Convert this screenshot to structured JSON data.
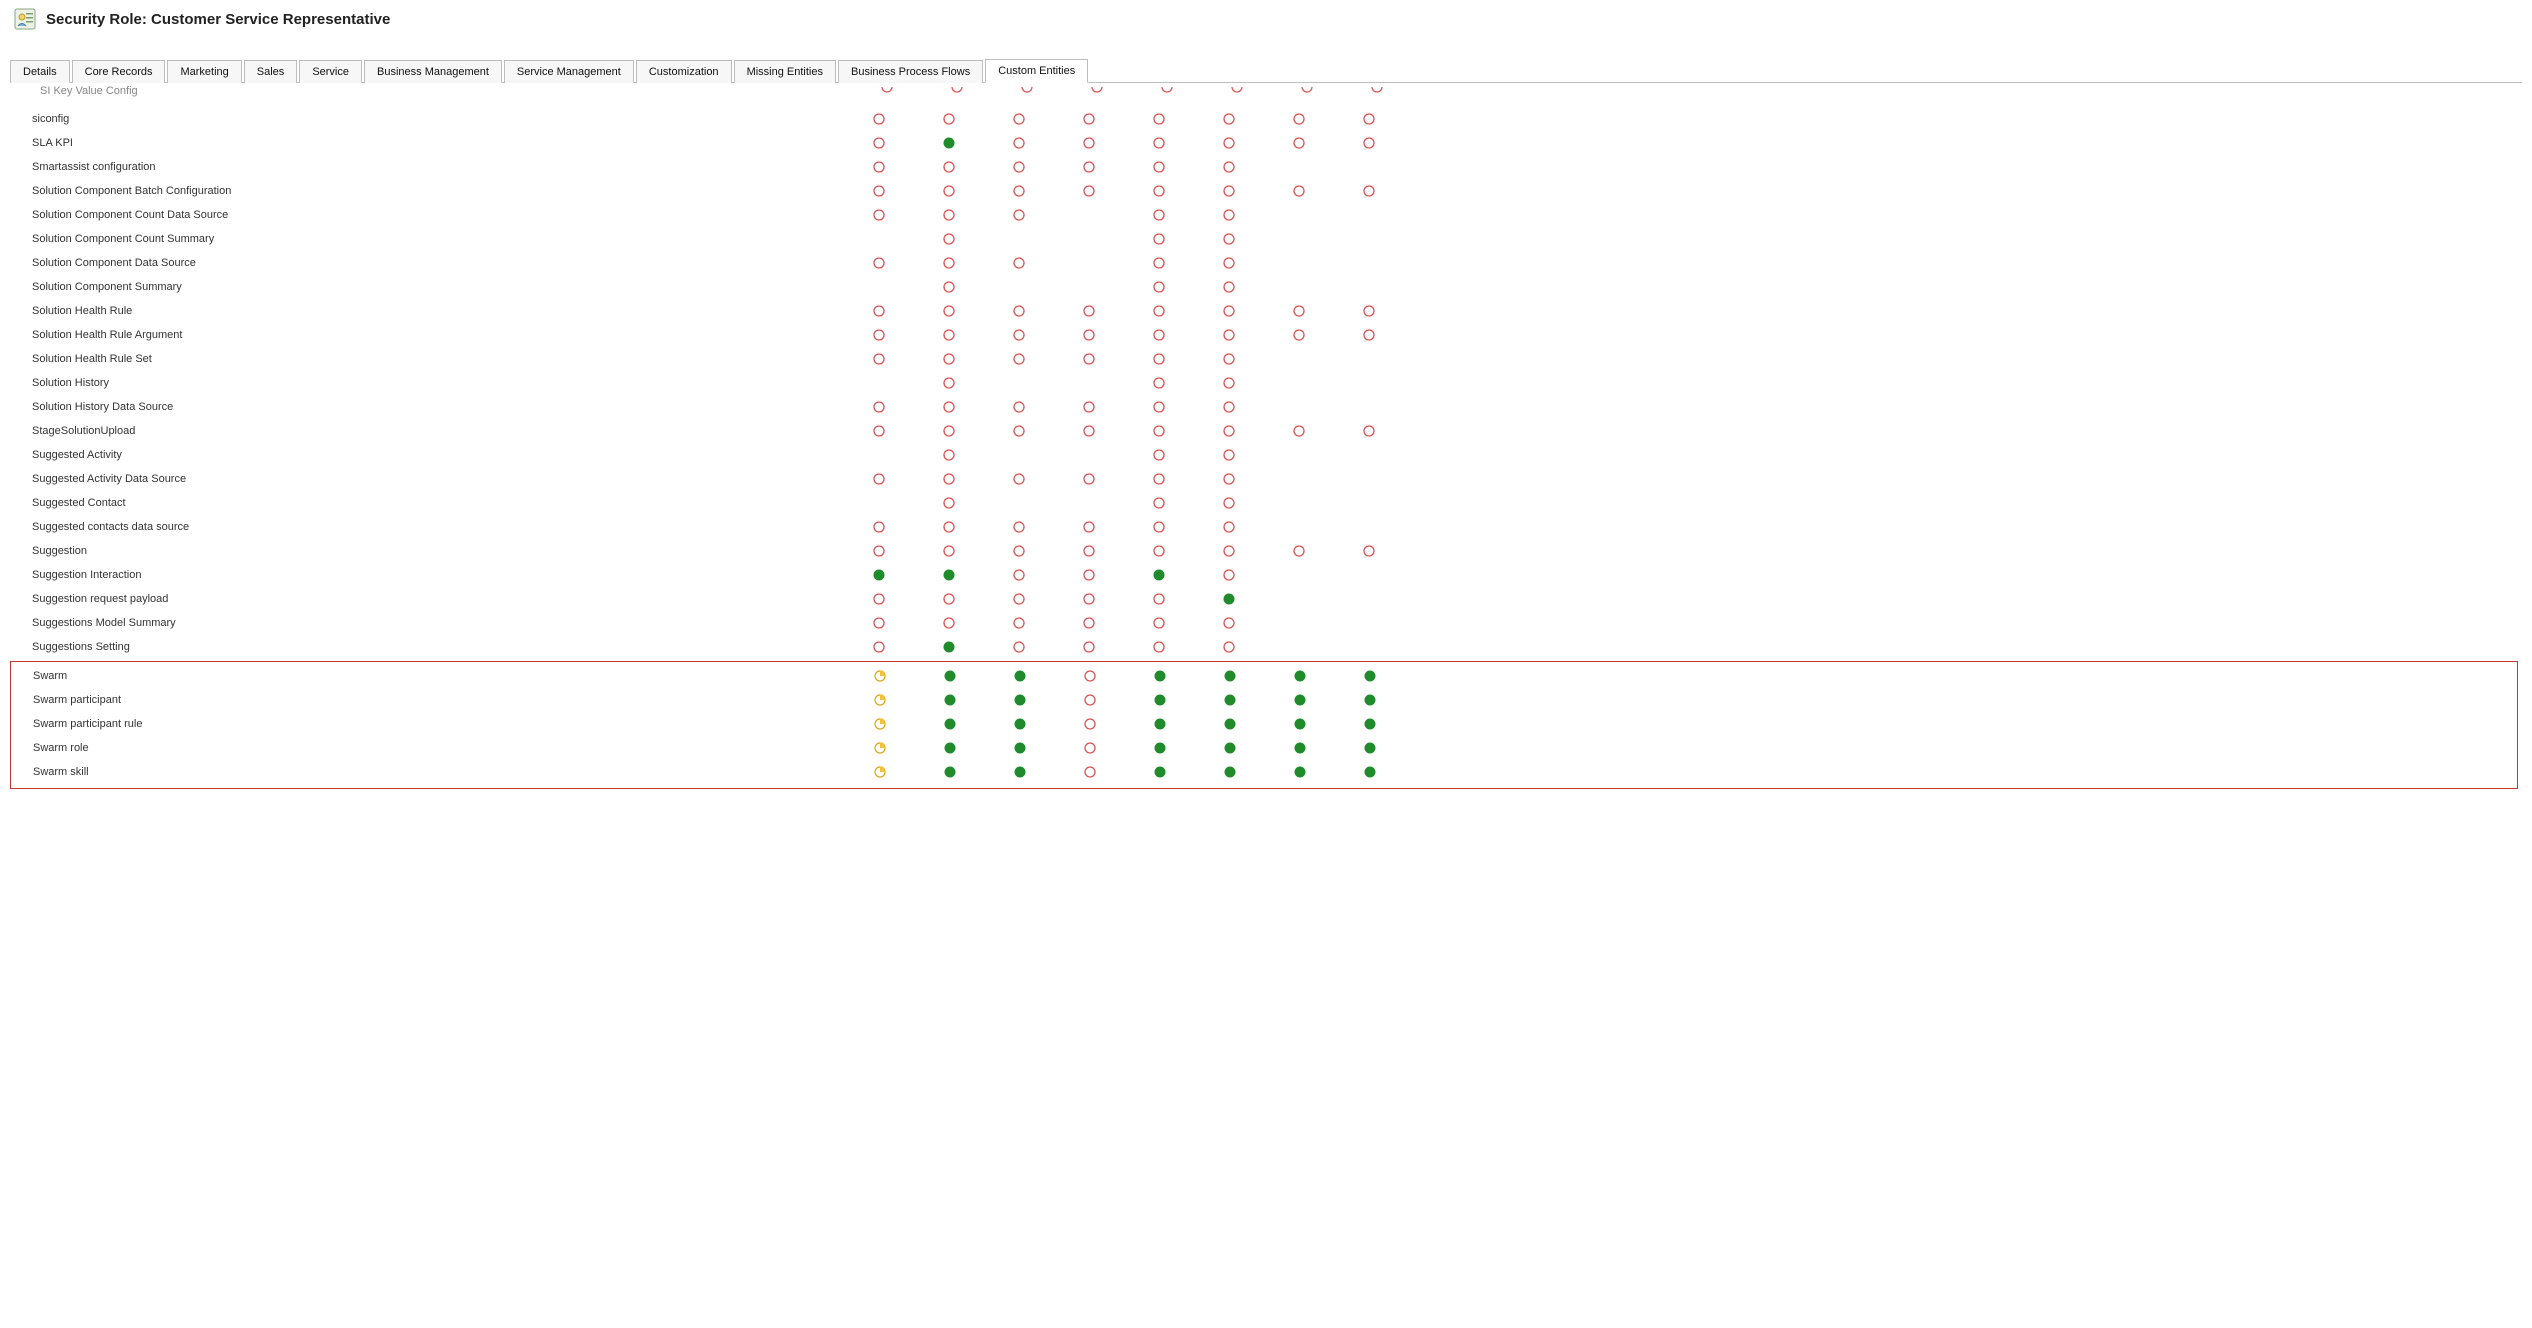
{
  "header": {
    "title": "Security Role: Customer Service Representative"
  },
  "tabs": [
    {
      "label": "Details"
    },
    {
      "label": "Core Records"
    },
    {
      "label": "Marketing"
    },
    {
      "label": "Sales"
    },
    {
      "label": "Service"
    },
    {
      "label": "Business Management"
    },
    {
      "label": "Service Management"
    },
    {
      "label": "Customization"
    },
    {
      "label": "Missing Entities"
    },
    {
      "label": "Business Process Flows"
    },
    {
      "label": "Custom Entities",
      "active": true
    }
  ],
  "privilegeCount": 8,
  "truncatedTop": "SI Key Value Config",
  "rows": [
    {
      "name": "siconfig",
      "priv": [
        "none",
        "none",
        "none",
        "none",
        "none",
        "none",
        "none",
        "none"
      ]
    },
    {
      "name": "SLA KPI",
      "priv": [
        "none",
        "org",
        "none",
        "none",
        "none",
        "none",
        "none",
        "none"
      ]
    },
    {
      "name": "Smartassist configuration",
      "priv": [
        "none",
        "none",
        "none",
        "none",
        "none",
        "none",
        "",
        ""
      ]
    },
    {
      "name": "Solution Component Batch Configuration",
      "priv": [
        "none",
        "none",
        "none",
        "none",
        "none",
        "none",
        "none",
        "none"
      ]
    },
    {
      "name": "Solution Component Count Data Source",
      "priv": [
        "none",
        "none",
        "none",
        "",
        "none",
        "none",
        "",
        ""
      ]
    },
    {
      "name": "Solution Component Count Summary",
      "priv": [
        "",
        "none",
        "",
        "",
        "none",
        "none",
        "",
        ""
      ]
    },
    {
      "name": "Solution Component Data Source",
      "priv": [
        "none",
        "none",
        "none",
        "",
        "none",
        "none",
        "",
        ""
      ]
    },
    {
      "name": "Solution Component Summary",
      "priv": [
        "",
        "none",
        "",
        "",
        "none",
        "none",
        "",
        ""
      ]
    },
    {
      "name": "Solution Health Rule",
      "priv": [
        "none",
        "none",
        "none",
        "none",
        "none",
        "none",
        "none",
        "none"
      ]
    },
    {
      "name": "Solution Health Rule Argument",
      "priv": [
        "none",
        "none",
        "none",
        "none",
        "none",
        "none",
        "none",
        "none"
      ]
    },
    {
      "name": "Solution Health Rule Set",
      "priv": [
        "none",
        "none",
        "none",
        "none",
        "none",
        "none",
        "",
        ""
      ]
    },
    {
      "name": "Solution History",
      "priv": [
        "",
        "none",
        "",
        "",
        "none",
        "none",
        "",
        ""
      ]
    },
    {
      "name": "Solution History Data Source",
      "priv": [
        "none",
        "none",
        "none",
        "none",
        "none",
        "none",
        "",
        ""
      ]
    },
    {
      "name": "StageSolutionUpload",
      "priv": [
        "none",
        "none",
        "none",
        "none",
        "none",
        "none",
        "none",
        "none"
      ]
    },
    {
      "name": "Suggested Activity",
      "priv": [
        "",
        "none",
        "",
        "",
        "none",
        "none",
        "",
        ""
      ]
    },
    {
      "name": "Suggested Activity Data Source",
      "priv": [
        "none",
        "none",
        "none",
        "none",
        "none",
        "none",
        "",
        ""
      ]
    },
    {
      "name": "Suggested Contact",
      "priv": [
        "",
        "none",
        "",
        "",
        "none",
        "none",
        "",
        ""
      ]
    },
    {
      "name": "Suggested contacts data source",
      "priv": [
        "none",
        "none",
        "none",
        "none",
        "none",
        "none",
        "",
        ""
      ]
    },
    {
      "name": "Suggestion",
      "priv": [
        "none",
        "none",
        "none",
        "none",
        "none",
        "none",
        "none",
        "none"
      ]
    },
    {
      "name": "Suggestion Interaction",
      "priv": [
        "org",
        "org",
        "none",
        "none",
        "org",
        "none",
        "",
        ""
      ]
    },
    {
      "name": "Suggestion request payload",
      "priv": [
        "none",
        "none",
        "none",
        "none",
        "none",
        "org",
        "",
        ""
      ]
    },
    {
      "name": "Suggestions Model Summary",
      "priv": [
        "none",
        "none",
        "none",
        "none",
        "none",
        "none",
        "",
        ""
      ]
    },
    {
      "name": "Suggestions Setting",
      "priv": [
        "none",
        "org",
        "none",
        "none",
        "none",
        "none",
        "",
        ""
      ]
    }
  ],
  "highlightRows": [
    {
      "name": "Swarm",
      "priv": [
        "user",
        "org",
        "org",
        "none",
        "org",
        "org",
        "org",
        "org"
      ]
    },
    {
      "name": "Swarm participant",
      "priv": [
        "user",
        "org",
        "org",
        "none",
        "org",
        "org",
        "org",
        "org"
      ]
    },
    {
      "name": "Swarm participant rule",
      "priv": [
        "user",
        "org",
        "org",
        "none",
        "org",
        "org",
        "org",
        "org"
      ]
    },
    {
      "name": "Swarm role",
      "priv": [
        "user",
        "org",
        "org",
        "none",
        "org",
        "org",
        "org",
        "org"
      ]
    },
    {
      "name": "Swarm skill",
      "priv": [
        "user",
        "org",
        "org",
        "none",
        "org",
        "org",
        "org",
        "org"
      ]
    }
  ]
}
